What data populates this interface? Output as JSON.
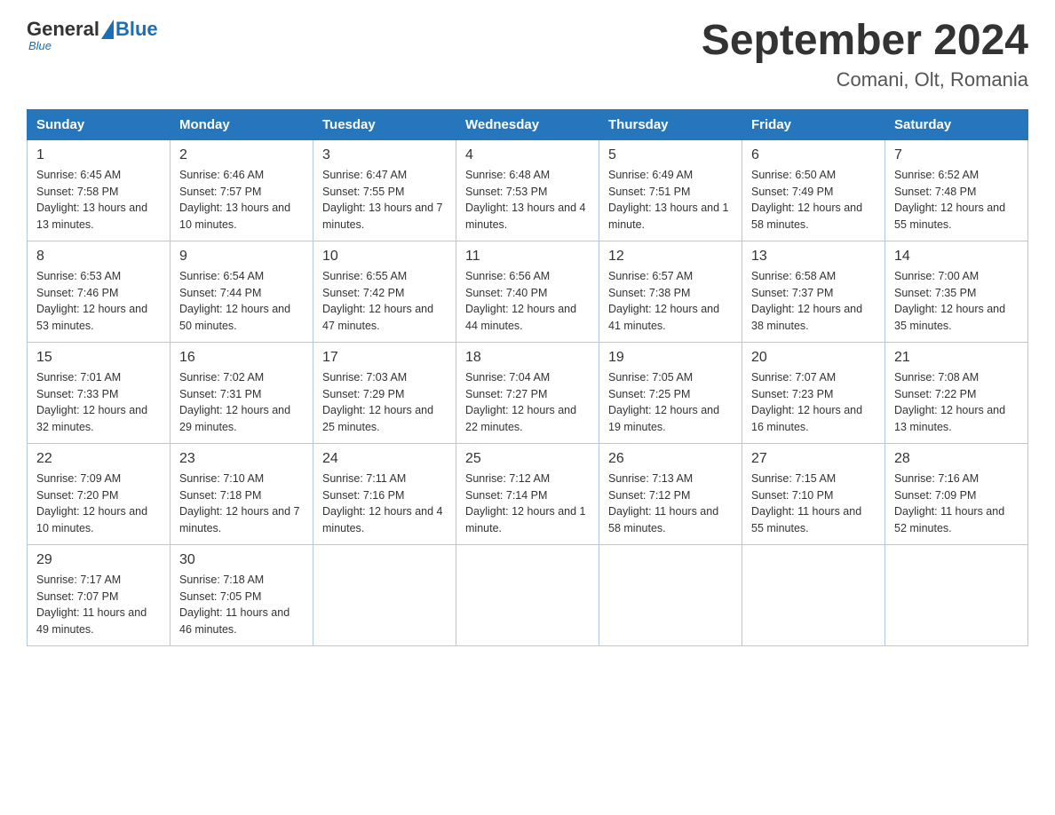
{
  "header": {
    "logo_general": "General",
    "logo_blue": "Blue",
    "title": "September 2024",
    "subtitle": "Comani, Olt, Romania"
  },
  "days_of_week": [
    "Sunday",
    "Monday",
    "Tuesday",
    "Wednesday",
    "Thursday",
    "Friday",
    "Saturday"
  ],
  "weeks": [
    [
      {
        "day": "1",
        "sunrise": "6:45 AM",
        "sunset": "7:58 PM",
        "daylight": "13 hours and 13 minutes."
      },
      {
        "day": "2",
        "sunrise": "6:46 AM",
        "sunset": "7:57 PM",
        "daylight": "13 hours and 10 minutes."
      },
      {
        "day": "3",
        "sunrise": "6:47 AM",
        "sunset": "7:55 PM",
        "daylight": "13 hours and 7 minutes."
      },
      {
        "day": "4",
        "sunrise": "6:48 AM",
        "sunset": "7:53 PM",
        "daylight": "13 hours and 4 minutes."
      },
      {
        "day": "5",
        "sunrise": "6:49 AM",
        "sunset": "7:51 PM",
        "daylight": "13 hours and 1 minute."
      },
      {
        "day": "6",
        "sunrise": "6:50 AM",
        "sunset": "7:49 PM",
        "daylight": "12 hours and 58 minutes."
      },
      {
        "day": "7",
        "sunrise": "6:52 AM",
        "sunset": "7:48 PM",
        "daylight": "12 hours and 55 minutes."
      }
    ],
    [
      {
        "day": "8",
        "sunrise": "6:53 AM",
        "sunset": "7:46 PM",
        "daylight": "12 hours and 53 minutes."
      },
      {
        "day": "9",
        "sunrise": "6:54 AM",
        "sunset": "7:44 PM",
        "daylight": "12 hours and 50 minutes."
      },
      {
        "day": "10",
        "sunrise": "6:55 AM",
        "sunset": "7:42 PM",
        "daylight": "12 hours and 47 minutes."
      },
      {
        "day": "11",
        "sunrise": "6:56 AM",
        "sunset": "7:40 PM",
        "daylight": "12 hours and 44 minutes."
      },
      {
        "day": "12",
        "sunrise": "6:57 AM",
        "sunset": "7:38 PM",
        "daylight": "12 hours and 41 minutes."
      },
      {
        "day": "13",
        "sunrise": "6:58 AM",
        "sunset": "7:37 PM",
        "daylight": "12 hours and 38 minutes."
      },
      {
        "day": "14",
        "sunrise": "7:00 AM",
        "sunset": "7:35 PM",
        "daylight": "12 hours and 35 minutes."
      }
    ],
    [
      {
        "day": "15",
        "sunrise": "7:01 AM",
        "sunset": "7:33 PM",
        "daylight": "12 hours and 32 minutes."
      },
      {
        "day": "16",
        "sunrise": "7:02 AM",
        "sunset": "7:31 PM",
        "daylight": "12 hours and 29 minutes."
      },
      {
        "day": "17",
        "sunrise": "7:03 AM",
        "sunset": "7:29 PM",
        "daylight": "12 hours and 25 minutes."
      },
      {
        "day": "18",
        "sunrise": "7:04 AM",
        "sunset": "7:27 PM",
        "daylight": "12 hours and 22 minutes."
      },
      {
        "day": "19",
        "sunrise": "7:05 AM",
        "sunset": "7:25 PM",
        "daylight": "12 hours and 19 minutes."
      },
      {
        "day": "20",
        "sunrise": "7:07 AM",
        "sunset": "7:23 PM",
        "daylight": "12 hours and 16 minutes."
      },
      {
        "day": "21",
        "sunrise": "7:08 AM",
        "sunset": "7:22 PM",
        "daylight": "12 hours and 13 minutes."
      }
    ],
    [
      {
        "day": "22",
        "sunrise": "7:09 AM",
        "sunset": "7:20 PM",
        "daylight": "12 hours and 10 minutes."
      },
      {
        "day": "23",
        "sunrise": "7:10 AM",
        "sunset": "7:18 PM",
        "daylight": "12 hours and 7 minutes."
      },
      {
        "day": "24",
        "sunrise": "7:11 AM",
        "sunset": "7:16 PM",
        "daylight": "12 hours and 4 minutes."
      },
      {
        "day": "25",
        "sunrise": "7:12 AM",
        "sunset": "7:14 PM",
        "daylight": "12 hours and 1 minute."
      },
      {
        "day": "26",
        "sunrise": "7:13 AM",
        "sunset": "7:12 PM",
        "daylight": "11 hours and 58 minutes."
      },
      {
        "day": "27",
        "sunrise": "7:15 AM",
        "sunset": "7:10 PM",
        "daylight": "11 hours and 55 minutes."
      },
      {
        "day": "28",
        "sunrise": "7:16 AM",
        "sunset": "7:09 PM",
        "daylight": "11 hours and 52 minutes."
      }
    ],
    [
      {
        "day": "29",
        "sunrise": "7:17 AM",
        "sunset": "7:07 PM",
        "daylight": "11 hours and 49 minutes."
      },
      {
        "day": "30",
        "sunrise": "7:18 AM",
        "sunset": "7:05 PM",
        "daylight": "11 hours and 46 minutes."
      },
      null,
      null,
      null,
      null,
      null
    ]
  ],
  "labels": {
    "sunrise": "Sunrise:",
    "sunset": "Sunset:",
    "daylight": "Daylight:"
  }
}
